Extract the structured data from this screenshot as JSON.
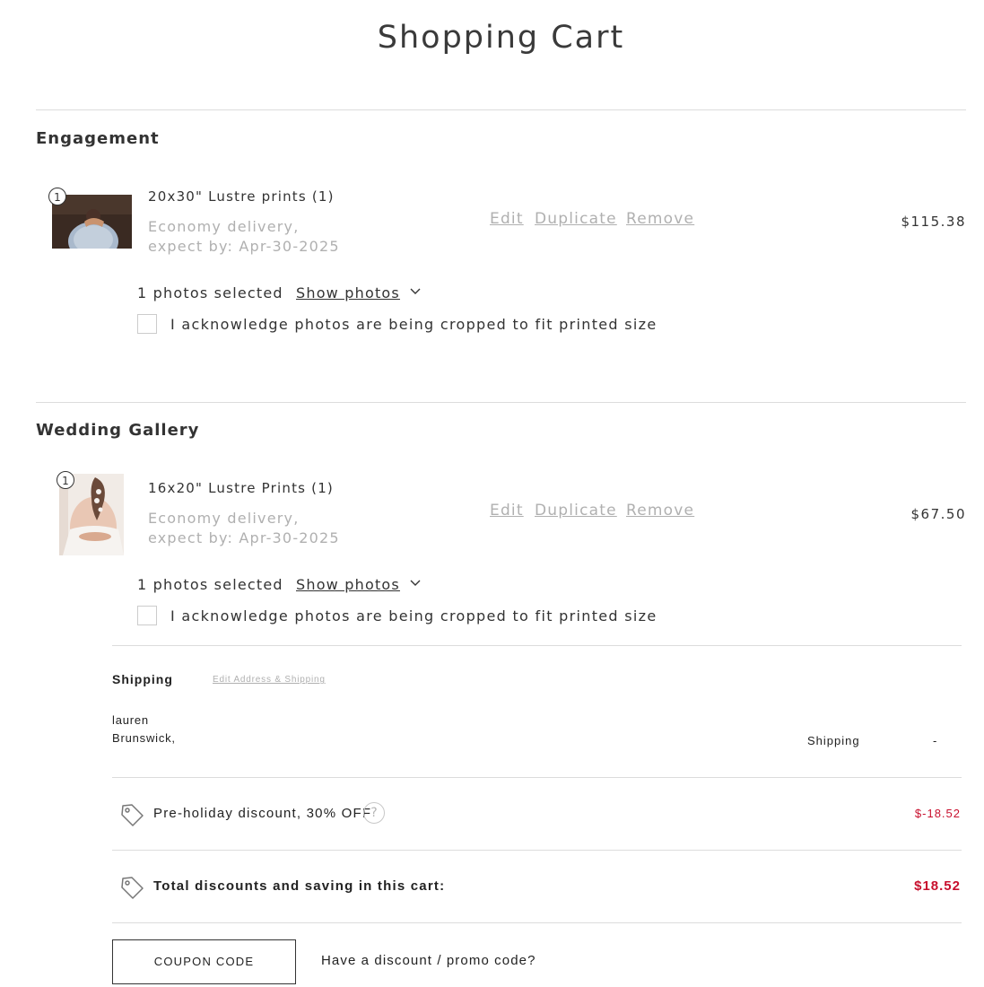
{
  "page": {
    "title": "Shopping Cart"
  },
  "sections": [
    {
      "title": "Engagement",
      "item": {
        "index": "1",
        "name": "20x30\" Lustre prints (1)",
        "delivery_line1": "Economy delivery,",
        "delivery_line2": "expect by: Apr-30-2025",
        "price": "$115.38",
        "photos_selected": "1 photos selected"
      }
    },
    {
      "title": "Wedding Gallery",
      "item": {
        "index": "1",
        "name": "16x20\" Lustre Prints (1)",
        "delivery_line1": "Economy delivery,",
        "delivery_line2": "expect by: Apr-30-2025",
        "price": "$67.50",
        "photos_selected": "1 photos selected"
      }
    }
  ],
  "actions": {
    "edit": "Edit",
    "duplicate": "Duplicate",
    "remove": "Remove",
    "show_photos": "Show photos"
  },
  "acknowledge_text": "I acknowledge photos are being cropped to fit printed size",
  "shipping": {
    "title": "Shipping",
    "edit_link": "Edit Address & Shipping",
    "name": "lauren",
    "city": "Brunswick,",
    "label": "Shipping",
    "value": "-"
  },
  "discount": {
    "label": "Pre-holiday discount, 30% OFF",
    "help": "?",
    "amount": "$-18.52"
  },
  "total_discount": {
    "label": "Total discounts and saving in this cart:",
    "amount": "$18.52"
  },
  "coupon": {
    "button": "COUPON CODE",
    "prompt": "Have a discount / promo code?"
  },
  "icons": {
    "chevron": "chevron-down-icon",
    "tag": "tag-icon",
    "help": "question-circle-icon"
  },
  "colors": {
    "discount_red": "#c8102e",
    "muted_text": "#b0b0b0",
    "divider": "#dcdcdc"
  }
}
